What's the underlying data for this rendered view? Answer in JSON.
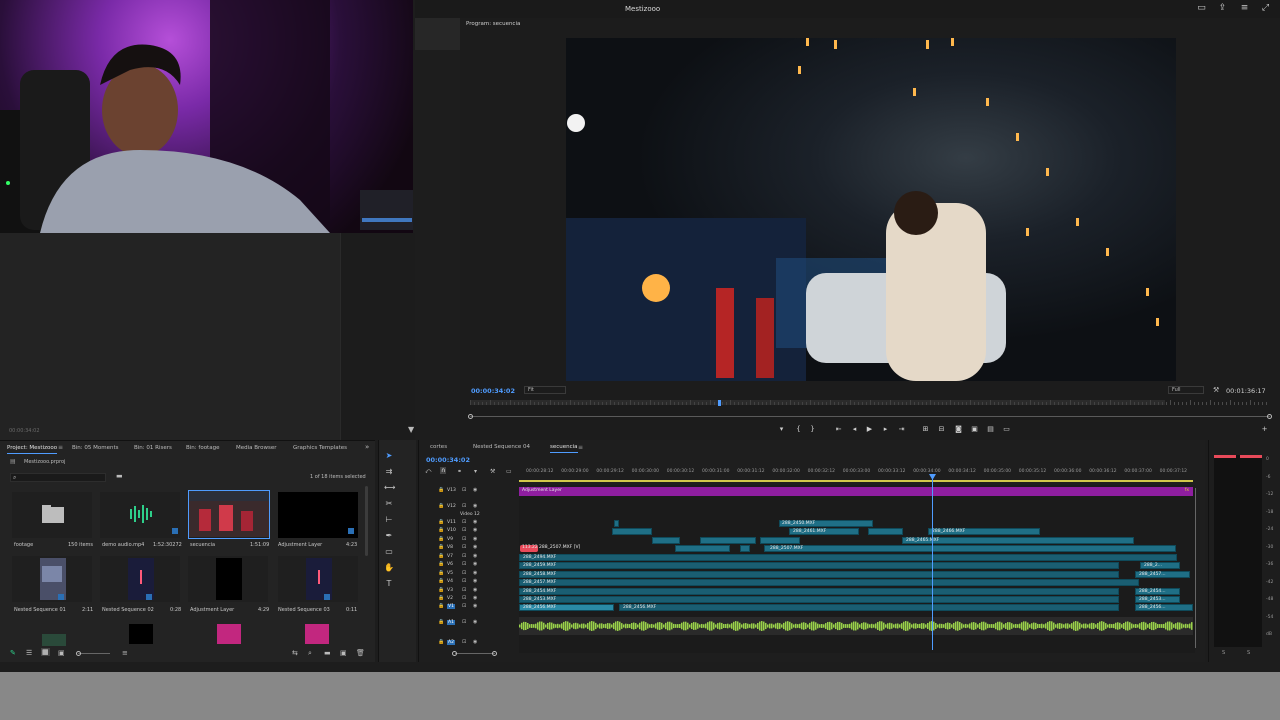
{
  "app": {
    "title": "Mestizooo"
  },
  "source": {
    "timecode": "00:00:34:02"
  },
  "program": {
    "title": "Program: secuencia",
    "timecode": "00:00:34:02",
    "fit": "Fit",
    "quality": "Full",
    "duration": "00:01:36:17",
    "playhead_fraction": 0.31
  },
  "project": {
    "tabs": [
      "Project: Mestizooo",
      "Bin: 05 Moments",
      "Bin: 01 Risers",
      "Bin: footage",
      "Media Browser",
      "Graphics Templates"
    ],
    "file": "Mestizooo.prproj",
    "items_selected": "1 of 18 items selected",
    "items": [
      {
        "name": "footage",
        "meta": "150 items"
      },
      {
        "name": "demo audio.mp4",
        "meta": "1:52:30272"
      },
      {
        "name": "secuencia",
        "meta": "1:51:09"
      },
      {
        "name": "Adjustment Layer",
        "meta": "4:23"
      },
      {
        "name": "Nested Sequence 01",
        "meta": "2:11"
      },
      {
        "name": "Nested Sequence 02",
        "meta": "0:28"
      },
      {
        "name": "Adjustment Layer",
        "meta": "4:29"
      },
      {
        "name": "Nested Sequence 03",
        "meta": "0:11"
      }
    ]
  },
  "timeline": {
    "tabs": [
      "cortes",
      "Nested Sequence 04",
      "secuencia"
    ],
    "timecode": "00:00:34:02",
    "ruler": [
      "00:00:28:12",
      "00:00:29:00",
      "00:00:29:12",
      "00:00:30:00",
      "00:00:30:12",
      "00:00:31:00",
      "00:00:31:12",
      "00:00:32:00",
      "00:00:32:12",
      "00:00:33:00",
      "00:00:33:12",
      "00:00:34:00",
      "00:00:34:12",
      "00:00:35:00",
      "00:00:35:12",
      "00:00:36:00",
      "00:00:36:12",
      "00:00:37:00",
      "00:00:37:12"
    ],
    "tracks": [
      "V13",
      "V12",
      "Video 12",
      "V11",
      "V10",
      "V9",
      "V8",
      "V7",
      "V6",
      "V5",
      "V4",
      "V3",
      "V2",
      "V1",
      "A1",
      "A2"
    ],
    "adjustment_label": "Adjustment Layer",
    "clips": {
      "v11a": "288_2450.MXF",
      "v10a": "288_2461.MXF",
      "v9a": "288_2465.MXF",
      "v10b": "288_2466.MXF",
      "v8a": "288_2507.MXF [V]",
      "v8b": "288_2507.MXF",
      "v8badge": "113.22",
      "v7": "288_2494.MXF",
      "v6": "288_2459.MXF",
      "v5": "288_2458.MXF",
      "v4": "288_2457.MXF",
      "v3": "288_2454.MXF",
      "v2": "288_2453.MXF",
      "v1a": "288_2456.MXF",
      "v1b": "288_2456.MXF",
      "r6": "288_2...",
      "r5": "288_2457...",
      "r3": "288_2454...",
      "r2": "288_2453...",
      "r1": "288_2456..."
    }
  },
  "meters": {
    "scale": [
      "0",
      "-6",
      "-12",
      "-18",
      "-24",
      "-30",
      "-36",
      "-42",
      "-48",
      "-54",
      "dB"
    ],
    "bottom": [
      "S",
      "S"
    ]
  },
  "colors": {
    "accent": "#4f9cff",
    "adjustment": "#8f1ea0",
    "clip": "#1f6f86",
    "audio": "#9ad24a"
  }
}
